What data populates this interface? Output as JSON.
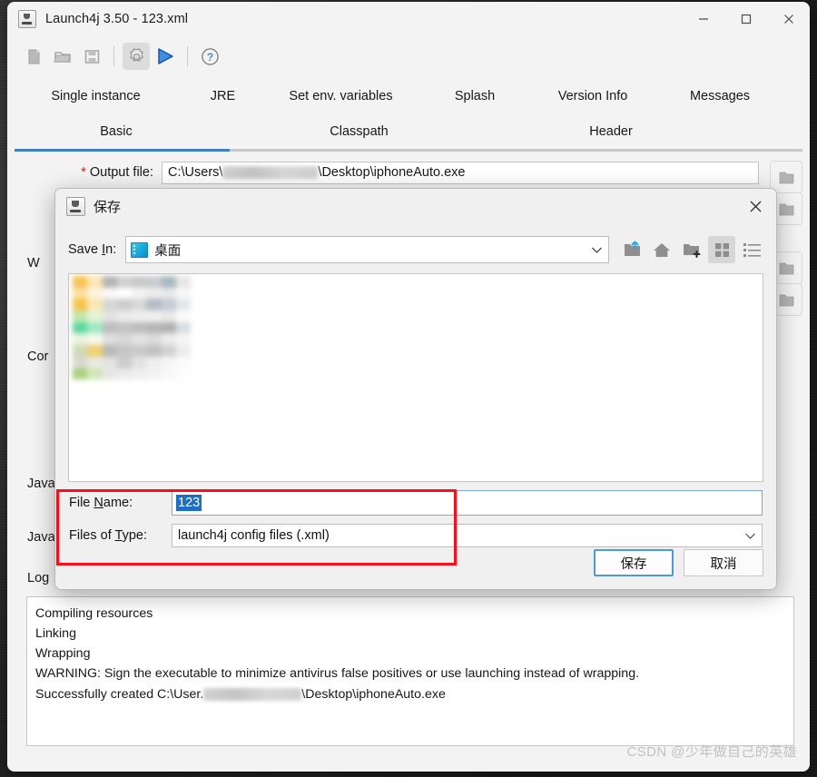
{
  "window": {
    "title": "Launch4j 3.50 - 123.xml",
    "app_icon": "java-coffee-icon",
    "controls": {
      "minimize": "minimize-icon",
      "maximize": "maximize-icon",
      "close": "close-icon"
    }
  },
  "toolbar": {
    "items": [
      {
        "name": "new-icon",
        "label": "New"
      },
      {
        "name": "open-icon",
        "label": "Open"
      },
      {
        "name": "save-icon",
        "label": "Save"
      },
      {
        "name": "build-gear-icon",
        "label": "Build wrapper"
      },
      {
        "name": "run-play-icon",
        "label": "Test run"
      },
      {
        "name": "help-question-icon",
        "label": "Help"
      }
    ]
  },
  "tabs": {
    "row1": [
      {
        "label": "Single instance",
        "selected": false
      },
      {
        "label": "JRE",
        "selected": false
      },
      {
        "label": "Set env. variables",
        "selected": false
      },
      {
        "label": "Splash",
        "selected": false
      },
      {
        "label": "Version Info",
        "selected": false
      },
      {
        "label": "Messages",
        "selected": false
      }
    ],
    "row2": [
      {
        "label": "Basic",
        "selected": true
      },
      {
        "label": "Classpath",
        "selected": false
      },
      {
        "label": "Header",
        "selected": false
      }
    ],
    "selected_color": "#3f7fc1"
  },
  "basic_panel": {
    "fields": [
      {
        "label": "* Output file:",
        "required": true,
        "value_prefix": "C:\\Users\\",
        "value_suffix": "\\Desktop\\iphoneAuto.exe",
        "redacted": true
      },
      {
        "label": "W",
        "truncated": true
      },
      {
        "label": "Cor",
        "truncated": true
      },
      {
        "label": "Java",
        "truncated": true
      },
      {
        "label": "Java",
        "truncated": true
      },
      {
        "label": "Log",
        "truncated": true
      }
    ],
    "browse_button_icon": "folder-icon"
  },
  "log": {
    "lines": [
      "Compiling resources",
      "Linking",
      "Wrapping",
      "WARNING: Sign the executable to minimize antivirus false positives or use launching instead of wrapping.",
      "Successfully created C:\\User.                       \\Desktop\\iphoneAuto.exe"
    ],
    "last_line_prefix": "Successfully created C:\\User.",
    "last_line_suffix": "\\Desktop\\iphoneAuto.exe"
  },
  "save_dialog": {
    "title": "保存",
    "icon": "java-coffee-icon",
    "close_label": "×",
    "save_in": {
      "label": "Save In:",
      "value": "桌面",
      "icon": "desktop-icon"
    },
    "toolbar": [
      {
        "name": "folder-up-icon",
        "active": false
      },
      {
        "name": "home-icon",
        "active": false
      },
      {
        "name": "new-folder-icon",
        "active": false
      },
      {
        "name": "grid-view-icon",
        "active": true
      },
      {
        "name": "list-view-icon",
        "active": false
      }
    ],
    "file_list": {
      "redacted": true,
      "items": []
    },
    "file_name": {
      "label_pre": "File ",
      "label_accel": "N",
      "label_post": "ame:",
      "value": "123",
      "selected": true
    },
    "files_of_type": {
      "label_pre": "Files of ",
      "label_accel": "T",
      "label_post": "ype:",
      "value": "launch4j config files (.xml)"
    },
    "buttons": {
      "save": "保存",
      "cancel": "取消"
    },
    "highlight_color": "#fc0d1c"
  },
  "watermark": "CSDN @少年做自己的英雄"
}
